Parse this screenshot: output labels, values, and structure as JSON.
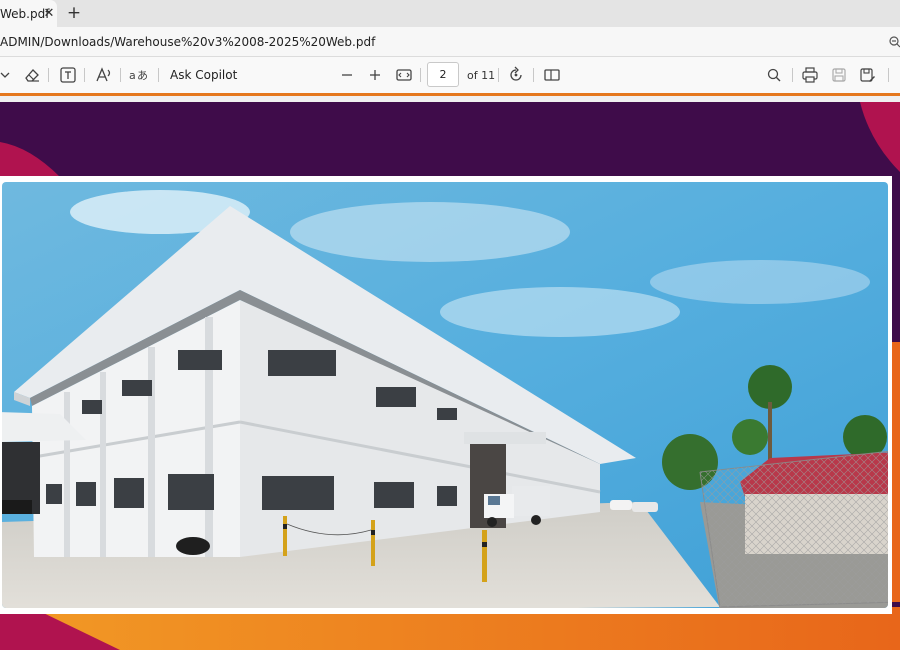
{
  "browser": {
    "tab": {
      "title": "Web.pdf",
      "close_glyph": "✕"
    },
    "new_tab_glyph": "+",
    "address": "ADMIN/Downloads/Warehouse%20v3%2008-2025%20Web.pdf"
  },
  "pdf_toolbar": {
    "ask_copilot": "Ask Copilot",
    "page_current": "2",
    "page_total": "of 11",
    "icons": [
      "chevron-down-icon",
      "eraser-icon",
      "text-box-icon",
      "read-aloud-icon",
      "translate-icon",
      "zoom-out-icon",
      "zoom-in-icon",
      "fit-width-icon",
      "rotate-icon",
      "page-view-icon",
      "search-icon",
      "print-icon",
      "save-icon",
      "save-as-icon"
    ]
  },
  "colors": {
    "accent_orange": "#e5781e",
    "page_purple": "#3f0c4a",
    "page_magenta": "#b0134f",
    "page_orange": "#e8661a"
  }
}
